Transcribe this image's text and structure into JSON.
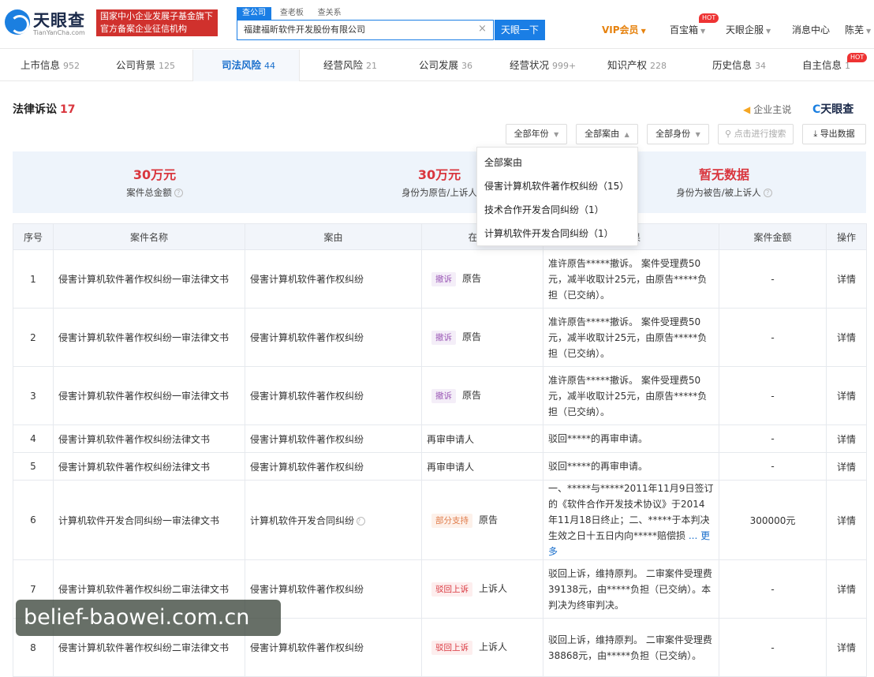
{
  "brand": {
    "logo_text": "天眼查",
    "logo_sub": "TianYanCha.com",
    "org_badge": [
      "国家中小企业发展子基金旗下",
      "官方备案企业征信机构"
    ]
  },
  "search": {
    "tabs": [
      "查公司",
      "查老板",
      "查关系"
    ],
    "value": "福建福昕软件开发股份有限公司",
    "button": "天眼一下"
  },
  "topnav": {
    "vip": "VIP会员",
    "treasure": "百宝箱",
    "hot": "HOT",
    "enterprise": "天眼企服",
    "messages": "消息中心",
    "user": "陈芜"
  },
  "tabs": [
    {
      "label": "上市信息",
      "count": "952"
    },
    {
      "label": "公司背景",
      "count": "125"
    },
    {
      "label": "司法风险",
      "count": "44"
    },
    {
      "label": "经营风险",
      "count": "21"
    },
    {
      "label": "公司发展",
      "count": "36"
    },
    {
      "label": "经营状况",
      "count": "999+"
    },
    {
      "label": "知识产权",
      "count": "228"
    },
    {
      "label": "历史信息",
      "count": "34"
    },
    {
      "label": "自主信息",
      "count": "1"
    }
  ],
  "tab_hot": "HOT",
  "section": {
    "title": "法律诉讼",
    "count": "17",
    "enterprise_say": "企业主说",
    "mark": "天眼查"
  },
  "filters": {
    "year": "全部年份",
    "reason": "全部案由",
    "identity": "全部身份",
    "search_placeholder": "点击进行搜索",
    "export": "导出数据"
  },
  "summary": [
    {
      "value": "30万元",
      "label": "案件总金额"
    },
    {
      "value": "30万元",
      "label": "身份为原告/上诉人"
    },
    {
      "value": "暂无数据",
      "label": "身份为被告/被上诉人"
    }
  ],
  "table": {
    "headers": [
      "序号",
      "案件名称",
      "案由",
      "在本案",
      "结果",
      "案件金额",
      "操作"
    ],
    "rows": [
      {
        "no": "1",
        "name": "侵害计算机软件著作权纠纷一审法律文书",
        "reason": "侵害计算机软件著作权纠纷",
        "tag": "撤诉",
        "role": "原告",
        "result": "准许原告*****撤诉。 案件受理费50元，减半收取计25元，由原告*****负担（已交纳）。",
        "amount": "-",
        "op": "详情"
      },
      {
        "no": "2",
        "name": "侵害计算机软件著作权纠纷一审法律文书",
        "reason": "侵害计算机软件著作权纠纷",
        "tag": "撤诉",
        "role": "原告",
        "result": "准许原告*****撤诉。 案件受理费50元，减半收取计25元，由原告*****负担（已交纳）。",
        "amount": "-",
        "op": "详情"
      },
      {
        "no": "3",
        "name": "侵害计算机软件著作权纠纷一审法律文书",
        "reason": "侵害计算机软件著作权纠纷",
        "tag": "撤诉",
        "role": "原告",
        "result": "准许原告*****撤诉。 案件受理费50元，减半收取计25元，由原告*****负担（已交纳）。",
        "amount": "-",
        "op": "详情"
      },
      {
        "no": "4",
        "name": "侵害计算机软件著作权纠纷法律文书",
        "reason": "侵害计算机软件著作权纠纷",
        "tag": "",
        "role": "再审申请人",
        "result": "驳回*****的再审申请。",
        "amount": "-",
        "op": "详情"
      },
      {
        "no": "5",
        "name": "侵害计算机软件著作权纠纷法律文书",
        "reason": "侵害计算机软件著作权纠纷",
        "tag": "",
        "role": "再审申请人",
        "result": "驳回*****的再审申请。",
        "amount": "-",
        "op": "详情"
      },
      {
        "no": "6",
        "name": "计算机软件开发合同纠纷一审法律文书",
        "reason": "计算机软件开发合同纠纷",
        "tag": "部分支持",
        "role": "原告",
        "result": "一、*****与*****2011年11月9日签订的《软件合作开发技术协议》于2014年11月18日终止；二、*****于本判决生效之日十五日内向*****赔偿损",
        "more": "... 更多",
        "amount": "300000元",
        "op": "详情"
      },
      {
        "no": "7",
        "name": "侵害计算机软件著作权纠纷二审法律文书",
        "reason": "侵害计算机软件著作权纠纷",
        "tag": "驳回上诉",
        "role": "上诉人",
        "result": "驳回上诉，维持原判。 二审案件受理费39138元，由*****负担（已交纳）。本判决为终审判决。",
        "amount": "-",
        "op": "详情"
      },
      {
        "no": "8",
        "name": "侵害计算机软件著作权纠纷二审法律文书",
        "reason": "侵害计算机软件著作权纠纷",
        "tag": "驳回上诉",
        "role": "上诉人",
        "result": "驳回上诉，维持原判。 二审案件受理费38868元，由*****负担（已交纳）。",
        "amount": "-",
        "op": "详情"
      }
    ]
  },
  "dropdown": [
    "全部案由",
    "侵害计算机软件著作权纠纷（15）",
    "技术合作开发合同纠纷（1）",
    "计算机软件开发合同纠纷（1）"
  ],
  "watermark": "belief-baowei.com.cn"
}
